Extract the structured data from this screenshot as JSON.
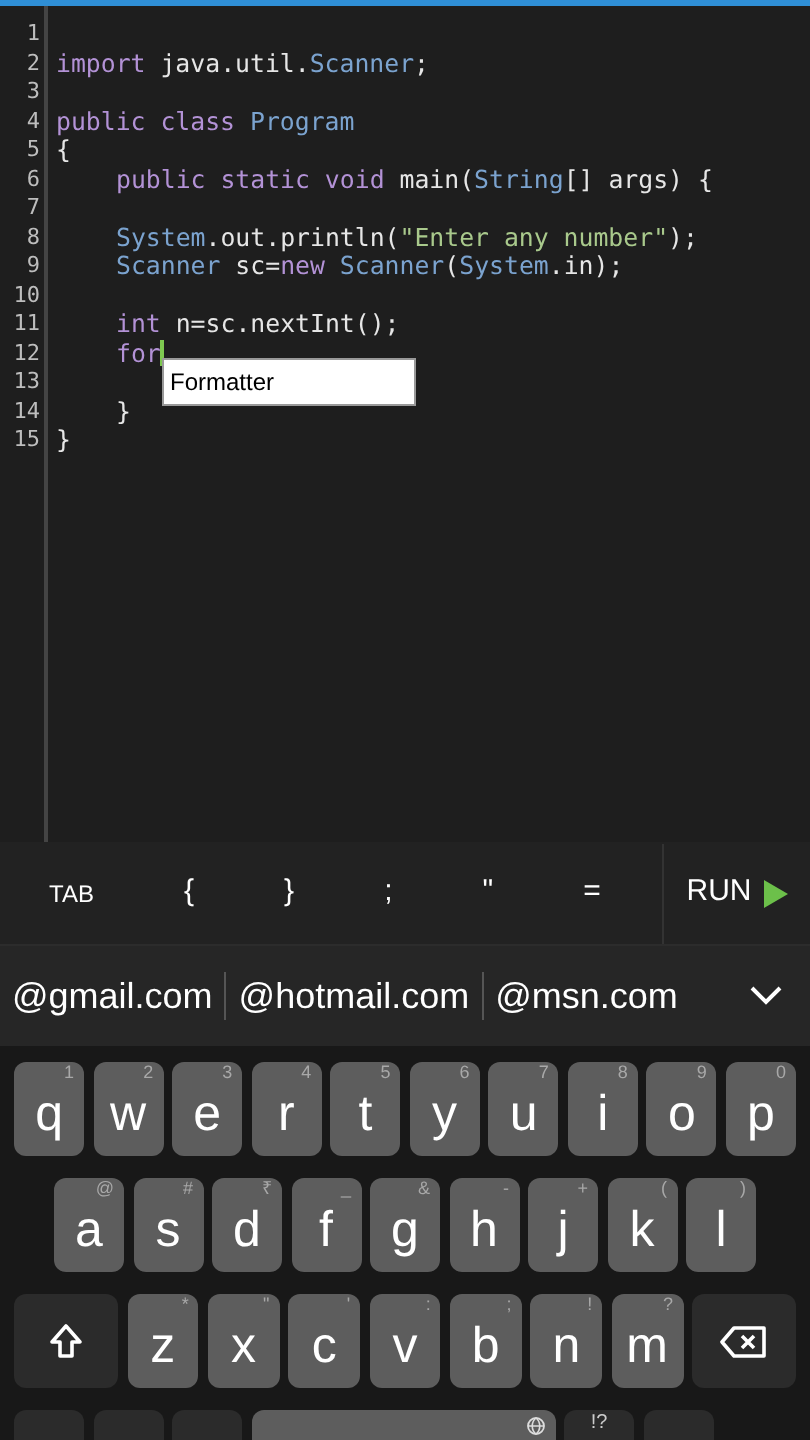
{
  "editor": {
    "lines": [
      {
        "number": "1",
        "cursor": false,
        "indented": false
      },
      {
        "number": "2",
        "cursor": false,
        "indented": false,
        "tokens": [
          {
            "text": "import",
            "kind": "keyword"
          },
          {
            "text": " java.util.",
            "kind": "plain"
          },
          {
            "text": "Scanner",
            "kind": "type"
          },
          {
            "text": ";",
            "kind": "plain"
          }
        ]
      },
      {
        "number": "3",
        "cursor": false,
        "indented": false
      },
      {
        "number": "4",
        "cursor": false,
        "indented": false,
        "tokens": [
          {
            "text": "public class",
            "kind": "keyword"
          },
          {
            "text": " Program",
            "kind": "type"
          }
        ]
      },
      {
        "number": "5",
        "cursor": false,
        "indented": false,
        "tokens": [
          {
            "text": "{",
            "kind": "plain"
          }
        ]
      },
      {
        "number": "6",
        "cursor": false,
        "indented": true,
        "tokens": [
          {
            "text": "public static void",
            "kind": "keyword"
          },
          {
            "text": " main(",
            "kind": "plain"
          },
          {
            "text": "String",
            "kind": "type"
          },
          {
            "text": "[] args) {",
            "kind": "plain"
          }
        ]
      },
      {
        "number": "7",
        "cursor": false,
        "indented": false
      },
      {
        "number": "8",
        "cursor": false,
        "indented": true,
        "tokens": [
          {
            "text": "System",
            "kind": "type"
          },
          {
            "text": ".out.println(",
            "kind": "plain"
          },
          {
            "text": "\"Enter any number\"",
            "kind": "string"
          },
          {
            "text": ");",
            "kind": "plain"
          }
        ]
      },
      {
        "number": "9",
        "cursor": false,
        "indented": true,
        "tokens": [
          {
            "text": "Scanner",
            "kind": "type"
          },
          {
            "text": " sc=",
            "kind": "plain"
          },
          {
            "text": "new",
            "kind": "keyword"
          },
          {
            "text": " Scanner",
            "kind": "type"
          },
          {
            "text": "(",
            "kind": "plain"
          },
          {
            "text": "System",
            "kind": "type"
          },
          {
            "text": ".in);",
            "kind": "plain"
          }
        ]
      },
      {
        "number": "10",
        "cursor": false,
        "indented": false
      },
      {
        "number": "11",
        "cursor": false,
        "indented": true,
        "tokens": [
          {
            "text": "int",
            "kind": "keyword"
          },
          {
            "text": " n=sc.nextInt();",
            "kind": "plain"
          }
        ]
      },
      {
        "number": "12",
        "cursor": true,
        "indented": true,
        "tokens": [
          {
            "text": "for",
            "kind": "keyword"
          }
        ]
      },
      {
        "number": "13",
        "cursor": false,
        "indented": false
      },
      {
        "number": "14",
        "cursor": false,
        "indented": true,
        "tokens": [
          {
            "text": "}",
            "kind": "plain"
          }
        ]
      },
      {
        "number": "15",
        "cursor": false,
        "indented": false,
        "tokens": [
          {
            "text": "}",
            "kind": "plain"
          }
        ]
      }
    ],
    "autocomplete": [
      "Formatter"
    ]
  },
  "toolbar": {
    "keys": [
      "TAB",
      "{",
      "}",
      ";",
      "\"",
      "="
    ],
    "run": "RUN"
  },
  "suggestions": [
    "@gmail.com",
    "@hotmail.com",
    "@msn.com"
  ],
  "keyboard": {
    "rows": [
      [
        {
          "kind": "letter",
          "label": "q",
          "hint": "1"
        },
        {
          "kind": "letter",
          "label": "w",
          "hint": "2"
        },
        {
          "kind": "letter",
          "label": "e",
          "hint": "3"
        },
        {
          "kind": "letter",
          "label": "r",
          "hint": "4"
        },
        {
          "kind": "letter",
          "label": "t",
          "hint": "5"
        },
        {
          "kind": "letter",
          "label": "y",
          "hint": "6"
        },
        {
          "kind": "letter",
          "label": "u",
          "hint": "7"
        },
        {
          "kind": "letter",
          "label": "i",
          "hint": "8"
        },
        {
          "kind": "letter",
          "label": "o",
          "hint": "9"
        },
        {
          "kind": "letter",
          "label": "p",
          "hint": "0"
        }
      ],
      [
        {
          "kind": "letter",
          "label": "a",
          "hint": "@"
        },
        {
          "kind": "letter",
          "label": "s",
          "hint": "#"
        },
        {
          "kind": "letter",
          "label": "d",
          "hint": "₹"
        },
        {
          "kind": "letter",
          "label": "f",
          "hint": "_"
        },
        {
          "kind": "letter",
          "label": "g",
          "hint": "&"
        },
        {
          "kind": "letter",
          "label": "h",
          "hint": "-"
        },
        {
          "kind": "letter",
          "label": "j",
          "hint": "+"
        },
        {
          "kind": "letter",
          "label": "k",
          "hint": "("
        },
        {
          "kind": "letter",
          "label": "l",
          "hint": ")"
        }
      ],
      [
        {
          "kind": "shift"
        },
        {
          "kind": "letter",
          "label": "z",
          "hint": "*"
        },
        {
          "kind": "letter",
          "label": "x",
          "hint": "\""
        },
        {
          "kind": "letter",
          "label": "c",
          "hint": "'"
        },
        {
          "kind": "letter",
          "label": "v",
          "hint": ":"
        },
        {
          "kind": "letter",
          "label": "b",
          "hint": ";"
        },
        {
          "kind": "letter",
          "label": "n",
          "hint": "!"
        },
        {
          "kind": "letter",
          "label": "m",
          "hint": "?"
        },
        {
          "kind": "backspace"
        }
      ],
      [
        {
          "kind": "dark"
        },
        {
          "kind": "dark"
        },
        {
          "kind": "dark"
        },
        {
          "kind": "space"
        },
        {
          "kind": "symbols",
          "hint": "!?"
        },
        {
          "kind": "dark"
        }
      ]
    ]
  }
}
